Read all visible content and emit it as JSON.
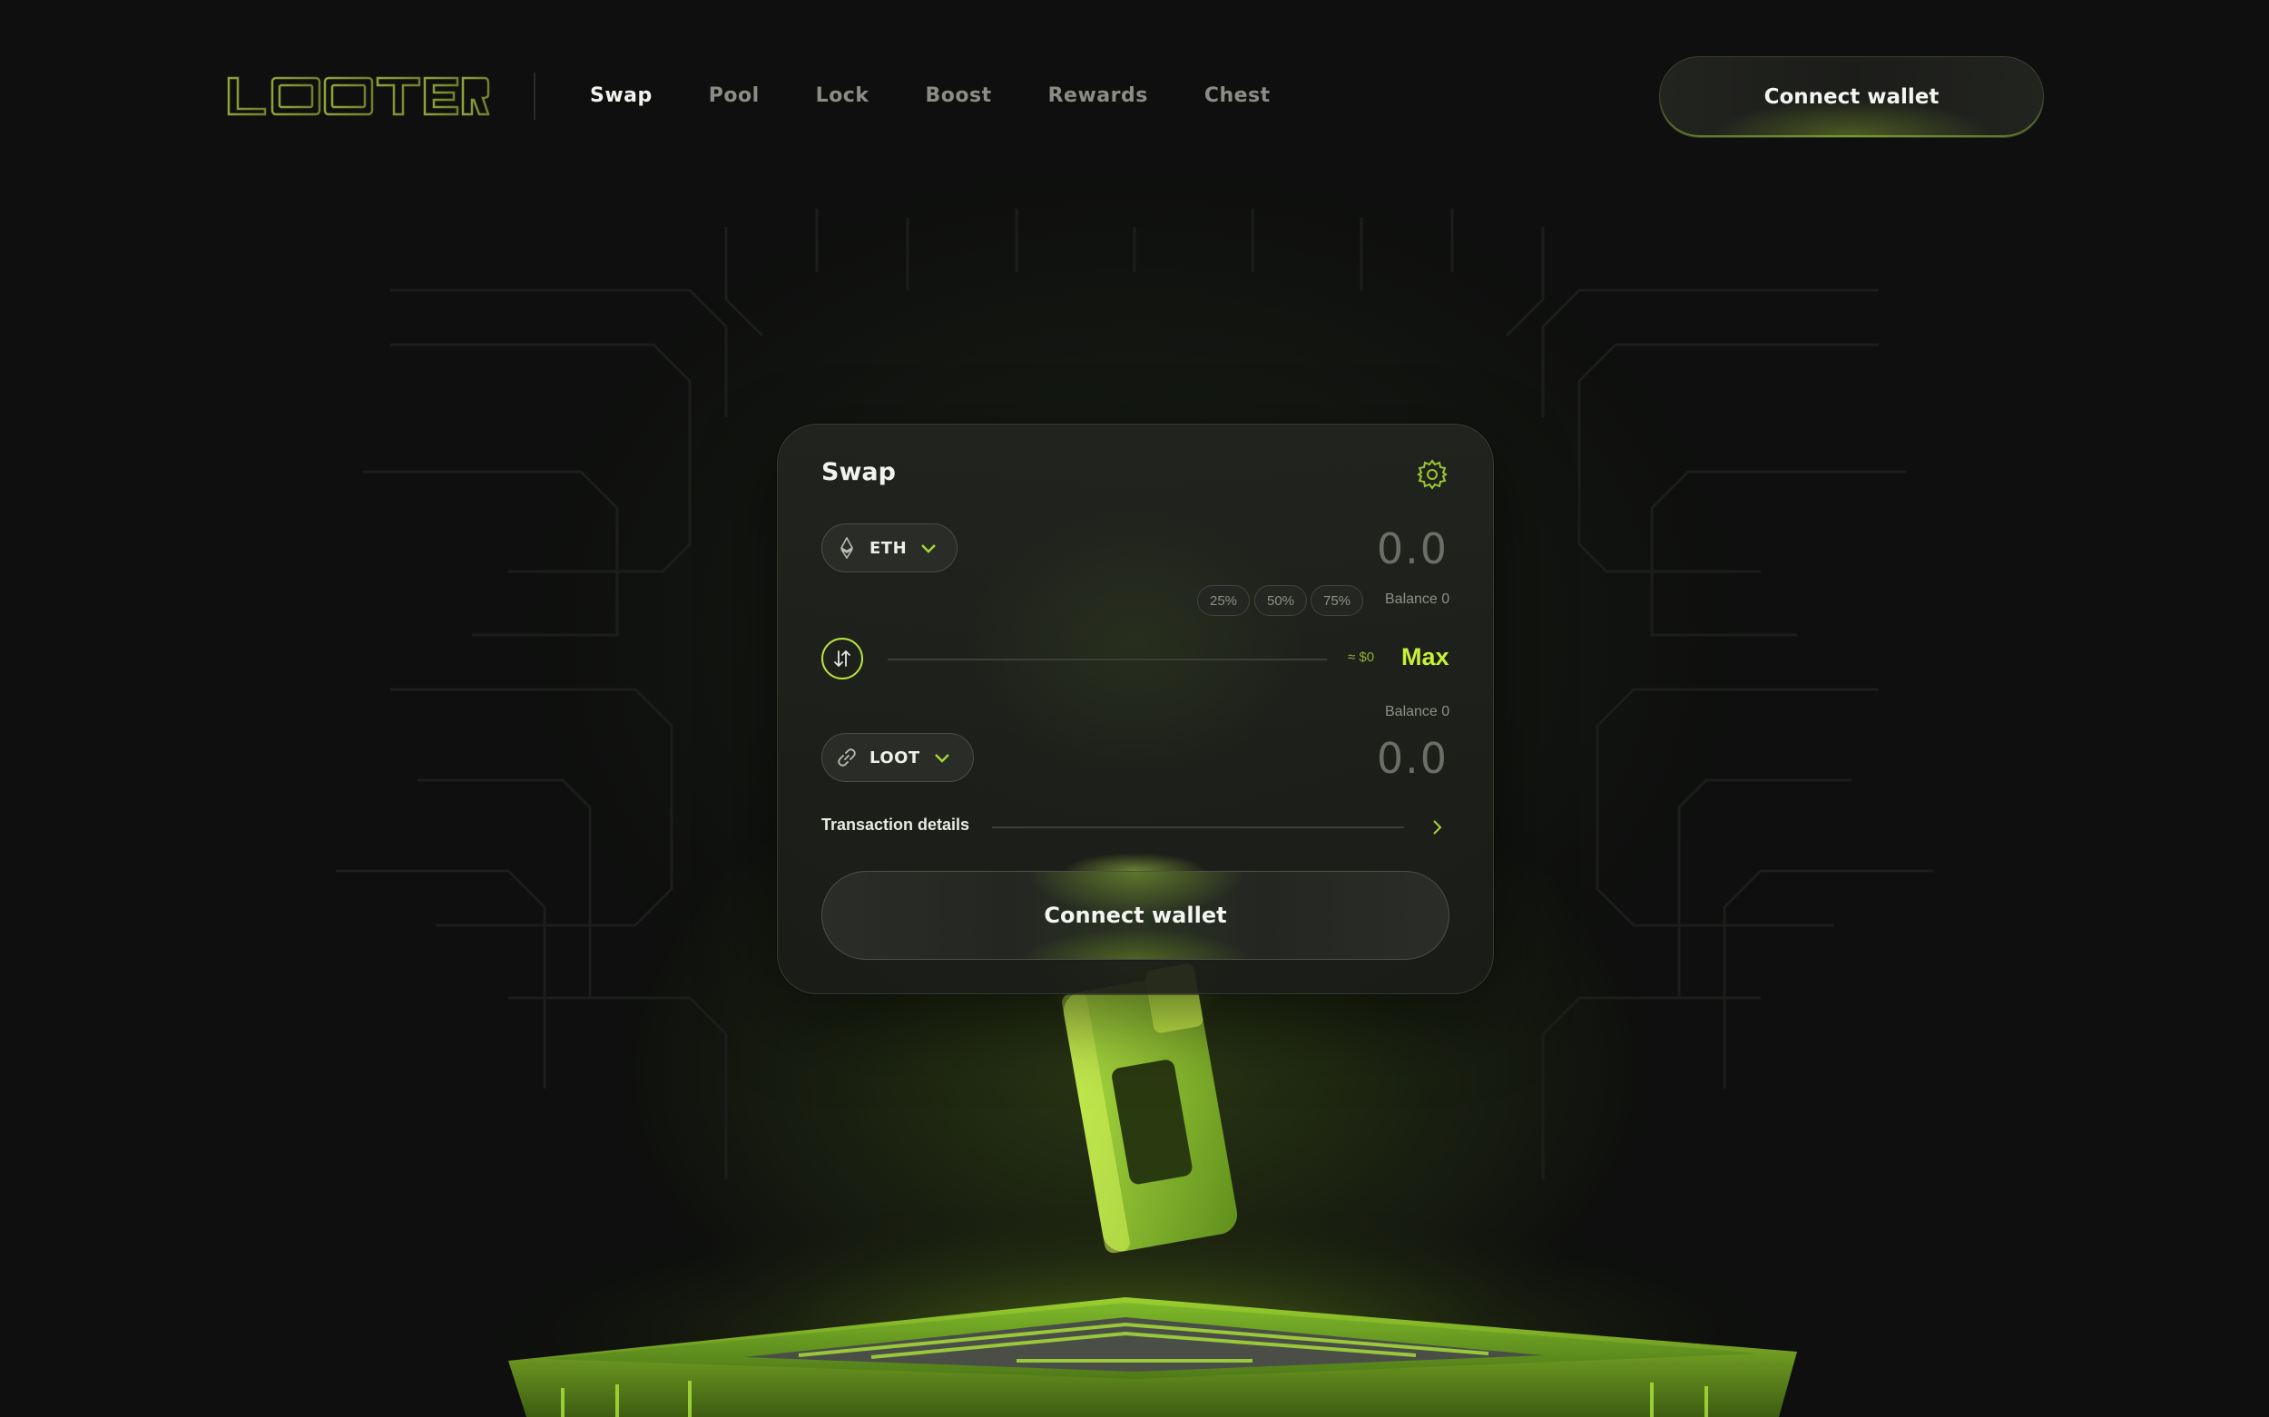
{
  "header": {
    "logo_text": "LOOTER",
    "nav": [
      {
        "label": "Swap",
        "active": true
      },
      {
        "label": "Pool",
        "active": false
      },
      {
        "label": "Lock",
        "active": false
      },
      {
        "label": "Boost",
        "active": false
      },
      {
        "label": "Rewards",
        "active": false
      },
      {
        "label": "Chest",
        "active": false
      }
    ],
    "connect_label": "Connect wallet"
  },
  "swap": {
    "title": "Swap",
    "settings_icon": "gear-icon",
    "from": {
      "token": "ETH",
      "token_icon": "ethereum-icon",
      "amount": "0.0",
      "percent_options": [
        "25%",
        "50%",
        "75%"
      ],
      "balance": "Balance 0"
    },
    "flip_icon": "swap-arrows-icon",
    "usd_estimate": "≈ $0",
    "max_label": "Max",
    "to": {
      "token": "LOOT",
      "token_icon": "link-icon",
      "balance": "Balance 0",
      "amount": "0.0"
    },
    "transaction_details_label": "Transaction details",
    "connect_label": "Connect wallet"
  },
  "colors": {
    "accent": "#c5f136",
    "background": "#0e0f0e",
    "card": "#22241f",
    "muted_text": "#8d9088"
  }
}
